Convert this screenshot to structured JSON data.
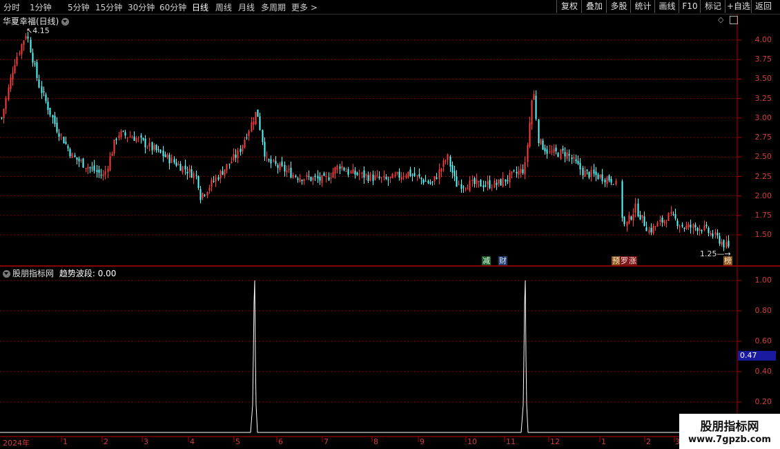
{
  "toolbar": {
    "timeframes": [
      "分时",
      "1分钟",
      "5分钟",
      "15分钟",
      "30分钟",
      "60分钟",
      "日线",
      "周线",
      "月线",
      "多周期",
      "更多"
    ],
    "active_timeframe": "日线",
    "right_buttons": [
      "复权",
      "叠加",
      "多股",
      "统计",
      "画线",
      "F10",
      "标记",
      "+自选",
      "返回"
    ]
  },
  "main_panel": {
    "title": "华夏幸福(日线)",
    "high_marker": "4.15",
    "low_marker": "1.25",
    "y_ticks": [
      "4.00",
      "3.75",
      "3.50",
      "3.25",
      "3.00",
      "2.75",
      "2.50",
      "2.25",
      "2.00",
      "1.75",
      "1.50"
    ],
    "event_tags": [
      {
        "text": "减",
        "color": "#2e8b57"
      },
      {
        "text": "财",
        "color": "#4a6fb0"
      },
      {
        "text": "预",
        "color": "#b87333"
      },
      {
        "text": "罗",
        "color": "#b03030"
      },
      {
        "text": "涨",
        "color": "#b03030"
      },
      {
        "text": "榜",
        "color": "#b87333"
      }
    ]
  },
  "indicator_panel": {
    "title": "股朋指标网",
    "indicator_label": "趋势波段: 0.00",
    "y_ticks": [
      "1.00",
      "0.80",
      "0.60",
      "0.40",
      "0.20"
    ],
    "current_value": "0.47"
  },
  "x_axis": {
    "labels": [
      "2024年",
      "1",
      "2",
      "3",
      "4",
      "5",
      "6",
      "7",
      "8",
      "9",
      "10",
      "11",
      "12",
      "1",
      "2",
      "3"
    ]
  },
  "watermark": {
    "line1": "股朋指标网",
    "line2": "www.7gpzb.com"
  },
  "colors": {
    "up": "#ff3c3c",
    "down": "#54ffff",
    "grid": "#8b0000",
    "axis_text": "#d23c3c",
    "indicator_line": "#ffffff",
    "value_box": "#1a1aa0"
  }
}
